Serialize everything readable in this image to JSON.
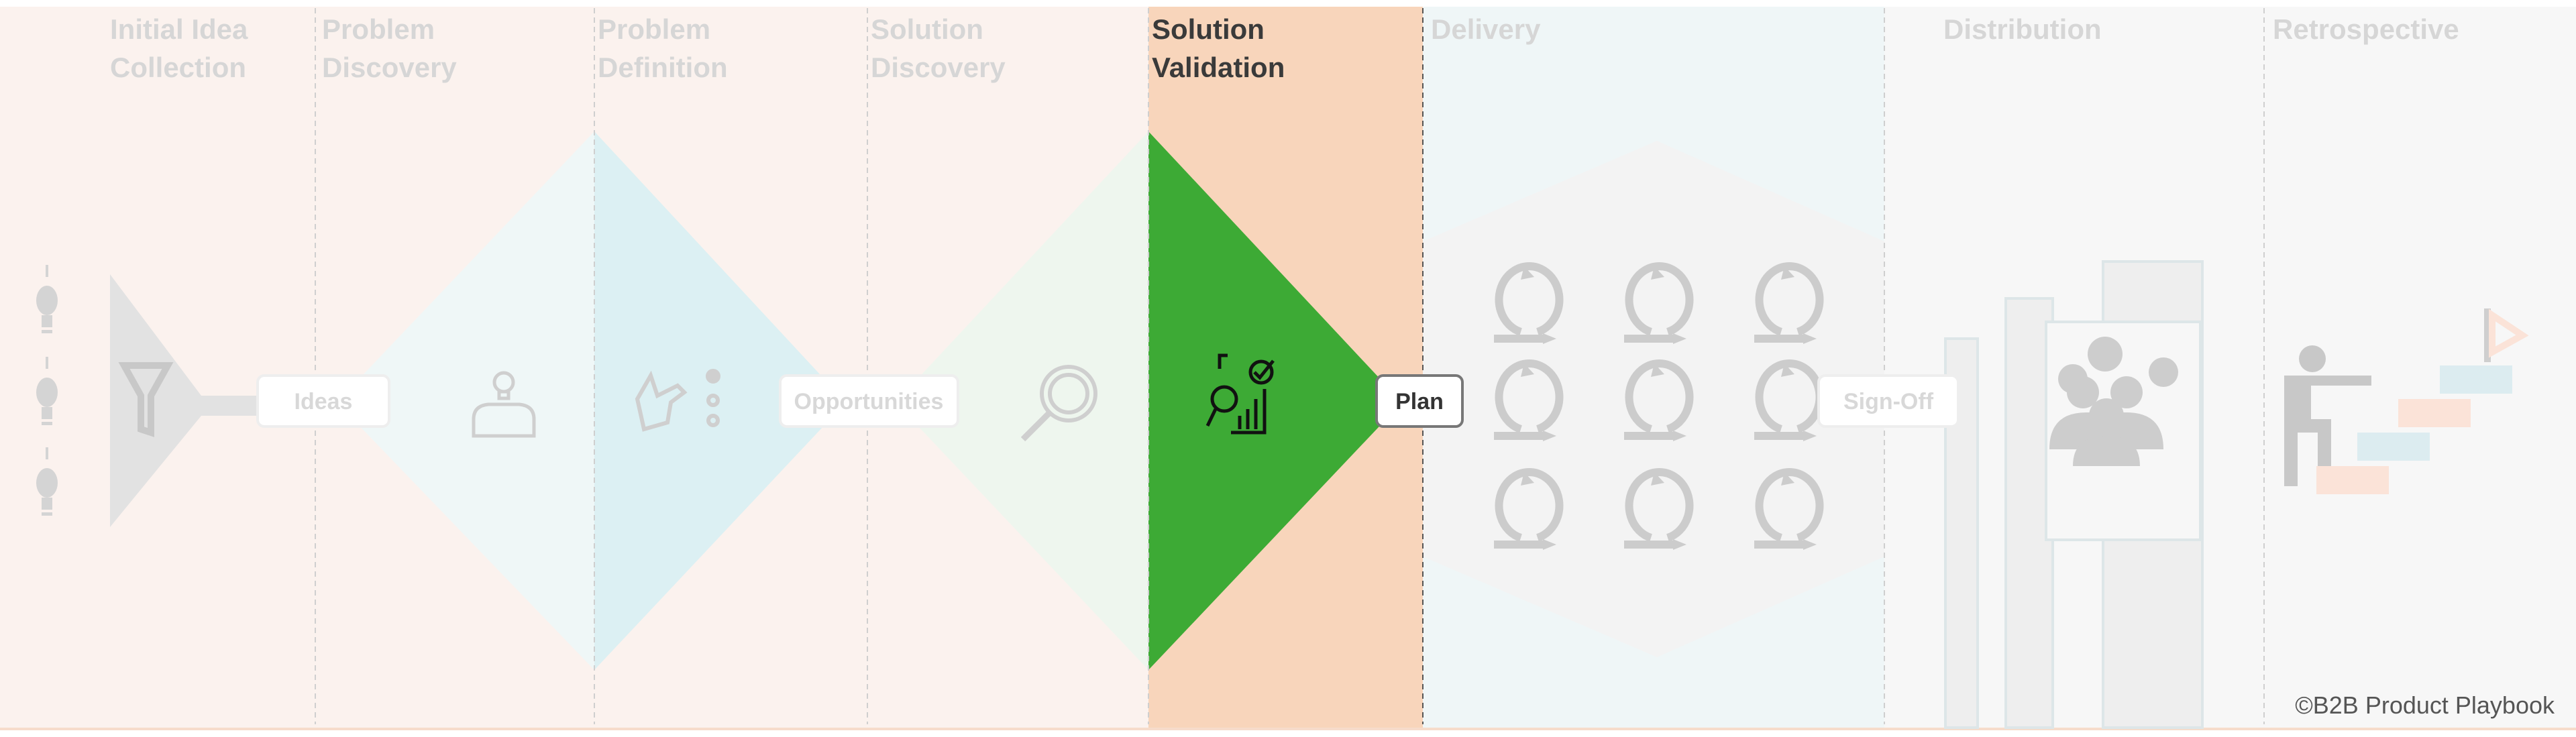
{
  "stages": [
    {
      "line1": "Initial Idea",
      "line2": "Collection"
    },
    {
      "line1": "Problem",
      "line2": "Discovery"
    },
    {
      "line1": "Problem",
      "line2": "Definition"
    },
    {
      "line1": "Solution",
      "line2": "Discovery"
    },
    {
      "line1": "Solution",
      "line2": "Validation"
    },
    {
      "line1": "Delivery",
      "line2": ""
    },
    {
      "line1": "Distribution",
      "line2": ""
    },
    {
      "line1": "Retrospective",
      "line2": ""
    }
  ],
  "active_stage": "Solution Validation",
  "milestones": {
    "ideas": "Ideas",
    "opportunities": "Opportunities",
    "plan": "Plan",
    "sign_off": "Sign-Off"
  },
  "copyright": "©B2B Product Playbook",
  "colors": {
    "early_bg": "#fbf2ee",
    "active_bg": "#f8d5bb",
    "active_triangle": "#3daa35",
    "delivery_bg": "#eff6f7",
    "late_bg": "#f7f7f7"
  }
}
